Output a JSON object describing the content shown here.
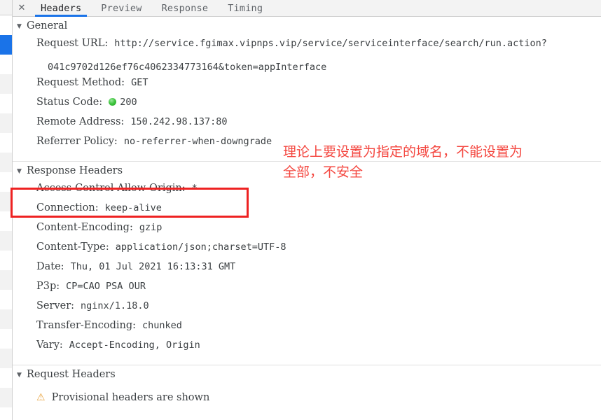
{
  "tabbar": {
    "close_label": "✕",
    "tabs": [
      {
        "label": "Headers",
        "active": true
      },
      {
        "label": "Preview",
        "active": false
      },
      {
        "label": "Response",
        "active": false
      },
      {
        "label": "Timing",
        "active": false
      }
    ]
  },
  "sections": {
    "general": {
      "title": "General",
      "twisty": "▼",
      "rows": {
        "request_url_key": "Request URL:",
        "request_url_value_line1": "http://service.fgimax.vipnps.vip/service/serviceinterface/search/run.action?",
        "request_url_value_line2": "041c9702d126ef76c4062334773164&token=appInterface",
        "request_method_key": "Request Method:",
        "request_method_value": "GET",
        "status_code_key": "Status Code:",
        "status_code_value": "200",
        "status_dot_name": "status-ok-dot",
        "remote_address_key": "Remote Address:",
        "remote_address_value": "150.242.98.137:80",
        "referrer_policy_key": "Referrer Policy:",
        "referrer_policy_value": "no-referrer-when-downgrade"
      }
    },
    "response_headers": {
      "title": "Response Headers",
      "twisty": "▼",
      "items": [
        {
          "key": "Access-Control-Allow-Origin:",
          "value": "*",
          "highlighted": true
        },
        {
          "key": "Connection:",
          "value": "keep-alive",
          "highlighted": false
        },
        {
          "key": "Content-Encoding:",
          "value": "gzip",
          "highlighted": false
        },
        {
          "key": "Content-Type:",
          "value": "application/json;charset=UTF-8",
          "highlighted": false
        },
        {
          "key": "Date:",
          "value": "Thu, 01 Jul 2021 16:13:31 GMT",
          "highlighted": false
        },
        {
          "key": "P3p:",
          "value": "CP=CAO PSA OUR",
          "highlighted": false
        },
        {
          "key": "Server:",
          "value": "nginx/1.18.0",
          "highlighted": false
        },
        {
          "key": "Transfer-Encoding:",
          "value": "chunked",
          "highlighted": false
        },
        {
          "key": "Vary:",
          "value": "Accept-Encoding, Origin",
          "highlighted": false
        }
      ]
    },
    "request_headers": {
      "title": "Request Headers",
      "twisty": "▼",
      "warning_icon": "⚠",
      "warning_text": "Provisional headers are shown"
    }
  },
  "annotation": {
    "text": "理论上要设置为指定的域名，不能设置为\n全部，不安全",
    "color": "#f4463f"
  },
  "colors": {
    "accent_blue": "#1a73e8",
    "highlight_red": "#ee2222",
    "status_green": "#24a524",
    "warning_amber": "#e8a33d",
    "text": "#3c4043"
  }
}
